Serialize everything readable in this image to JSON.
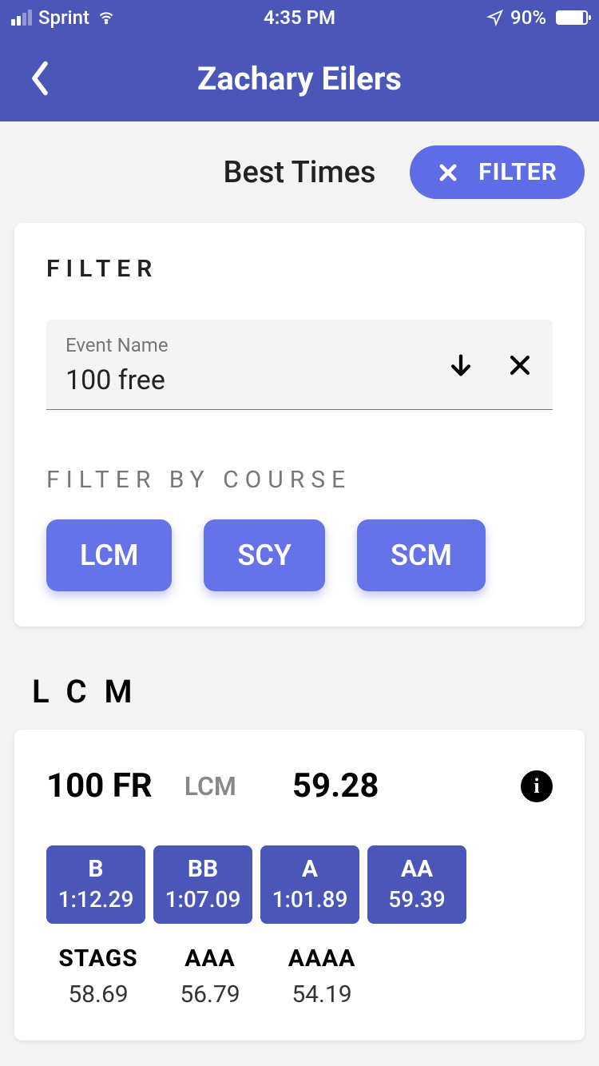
{
  "status": {
    "carrier": "Sprint",
    "time": "4:35 PM",
    "battery_pct": "90%",
    "battery_fill_width": "90%"
  },
  "nav": {
    "title": "Zachary Eilers"
  },
  "page": {
    "title": "Best Times",
    "filter_button": "FILTER"
  },
  "filter_card": {
    "label": "FILTER",
    "input_label": "Event Name",
    "input_value": "100 free",
    "course_label": "FILTER BY COURSE",
    "courses": [
      "LCM",
      "SCY",
      "SCM"
    ]
  },
  "section": {
    "label": "LCM"
  },
  "result": {
    "event": "100 FR",
    "course": "LCM",
    "time": "59.28",
    "standards_highlighted": [
      {
        "label": "B",
        "time": "1:12.29"
      },
      {
        "label": "BB",
        "time": "1:07.09"
      },
      {
        "label": "A",
        "time": "1:01.89"
      },
      {
        "label": "AA",
        "time": "59.39"
      }
    ],
    "standards_plain": [
      {
        "label": "STAGS",
        "time": "58.69"
      },
      {
        "label": "AAA",
        "time": "56.79"
      },
      {
        "label": "AAAA",
        "time": "54.19"
      }
    ]
  }
}
